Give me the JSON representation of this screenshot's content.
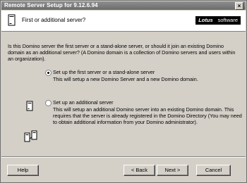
{
  "window": {
    "title": "Remote Server Setup for 9.12.6.94",
    "close_glyph": "×"
  },
  "header": {
    "question": "First or additional server?",
    "logo_brand": "Lotus",
    "logo_suffix": "software"
  },
  "intro_text": "Is this Domino server the first server or a stand-alone server, or should it join an existing Domino domain as an additional server? (A Domino domain is a collection of Domino servers and users within an organization).",
  "options": [
    {
      "label": "Set up the first server or a stand-alone server",
      "description": "This will setup a new Domino Server and a new Domino domain.",
      "selected": true,
      "icon": "single-server-icon"
    },
    {
      "label": "Set up an additional server",
      "description": "This will setup an additional Domino server into an existing Domino domain. This requires that the server is already registered in the Domino Directory (You may need to obtain additional information from your Domino administrator).",
      "selected": false,
      "icon": "multi-server-icon"
    }
  ],
  "buttons": {
    "help": "Help",
    "back": "< Back",
    "next": "Next >",
    "cancel": "Cancel"
  },
  "colors": {
    "titlebar": "#7a7a7a",
    "dialog_bg": "#d4d0c8",
    "logo_bg": "#000000"
  }
}
